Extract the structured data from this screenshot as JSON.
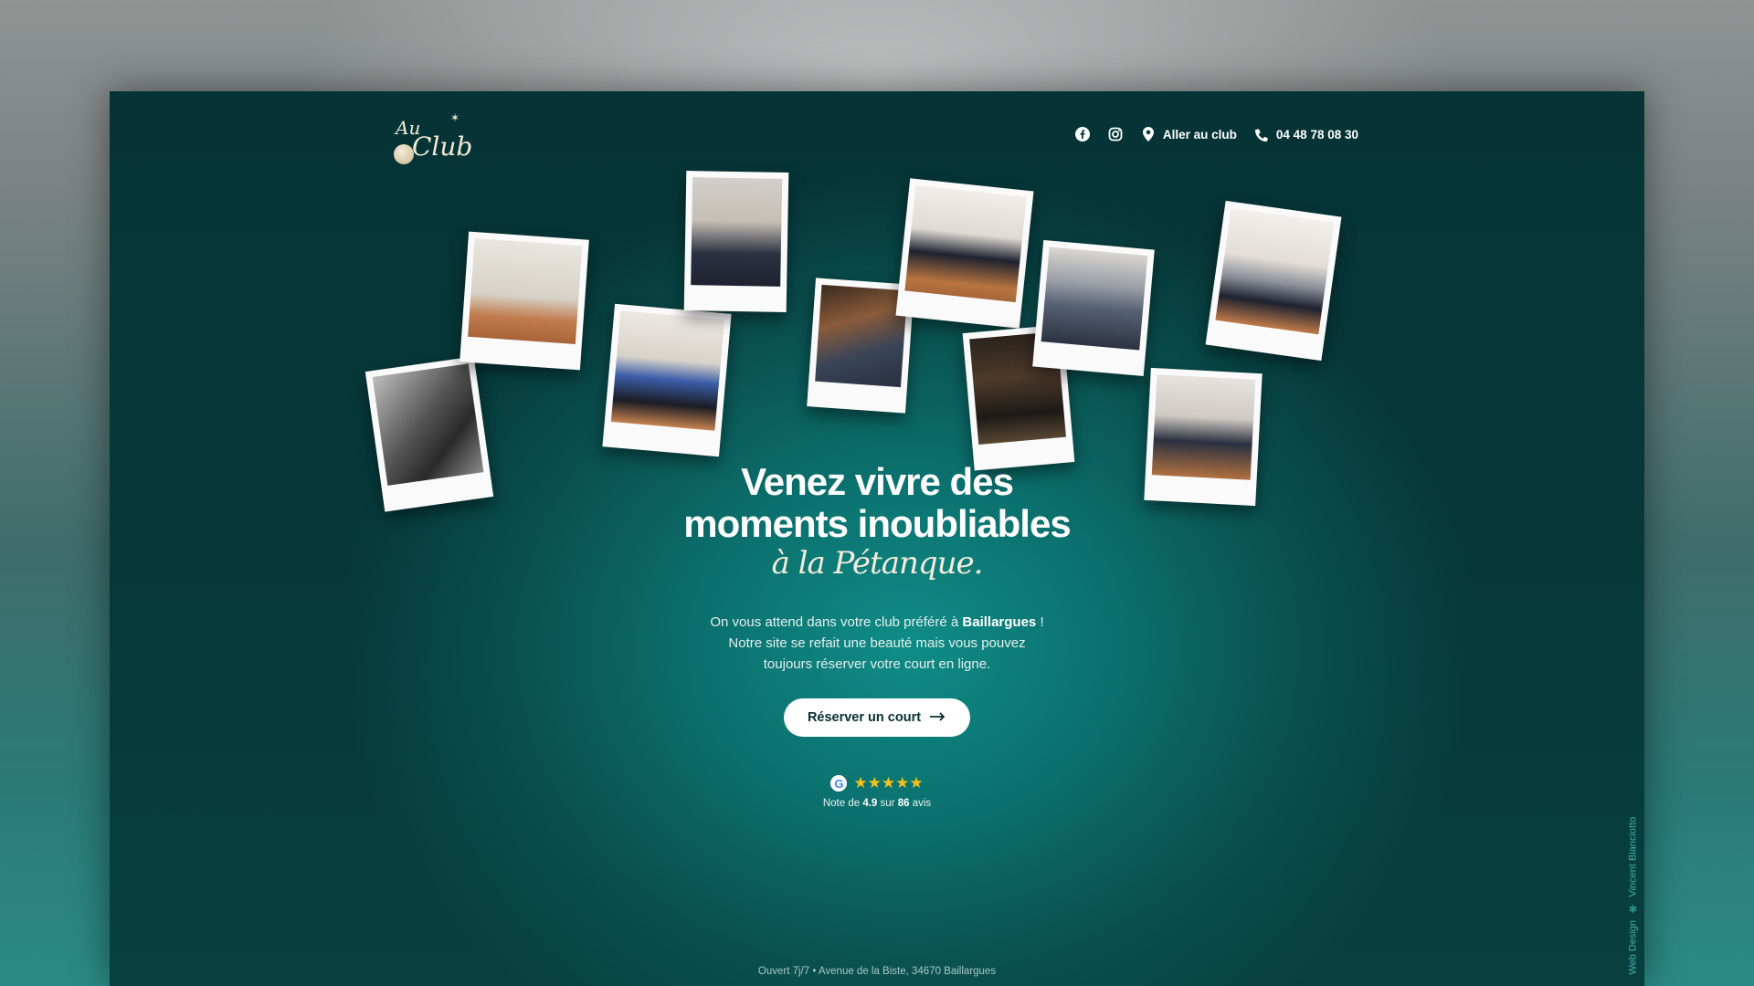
{
  "header": {
    "logo_top": "Au",
    "logo_main": "Club",
    "nav_directions": "Aller au club",
    "nav_phone": "04 48 78 08 30"
  },
  "hero": {
    "title_line1": "Venez vivre des",
    "title_line2": "moments inoubliables",
    "title_script": "à la Pétanque.",
    "desc_part1": "On vous attend dans votre club préféré à",
    "desc_city": "Baillargues",
    "desc_part2": "!",
    "desc_line2": "Notre site se refait une beauté mais vous pouvez",
    "desc_line3": "toujours réserver votre court en ligne.",
    "cta_label": "Réserver un court"
  },
  "rating": {
    "stars": "★★★★★",
    "prefix": "Note de",
    "score": "4.9",
    "mid": "sur",
    "count": "86",
    "suffix": "avis"
  },
  "footer": {
    "info": "Ouvert 7j/7 • Avenue de la Biste, 34670 Baillargues"
  },
  "credit": {
    "label": "Web Design",
    "author": "Vincent Bianciotto"
  },
  "colors": {
    "background": "#063436",
    "accent_teal": "#0f8c87",
    "star": "#f6c21a",
    "cta_bg": "#ffffff"
  },
  "icons": [
    "facebook-icon",
    "instagram-icon",
    "map-pin-icon",
    "phone-icon",
    "arrow-right-icon",
    "google-icon",
    "star-icon"
  ]
}
